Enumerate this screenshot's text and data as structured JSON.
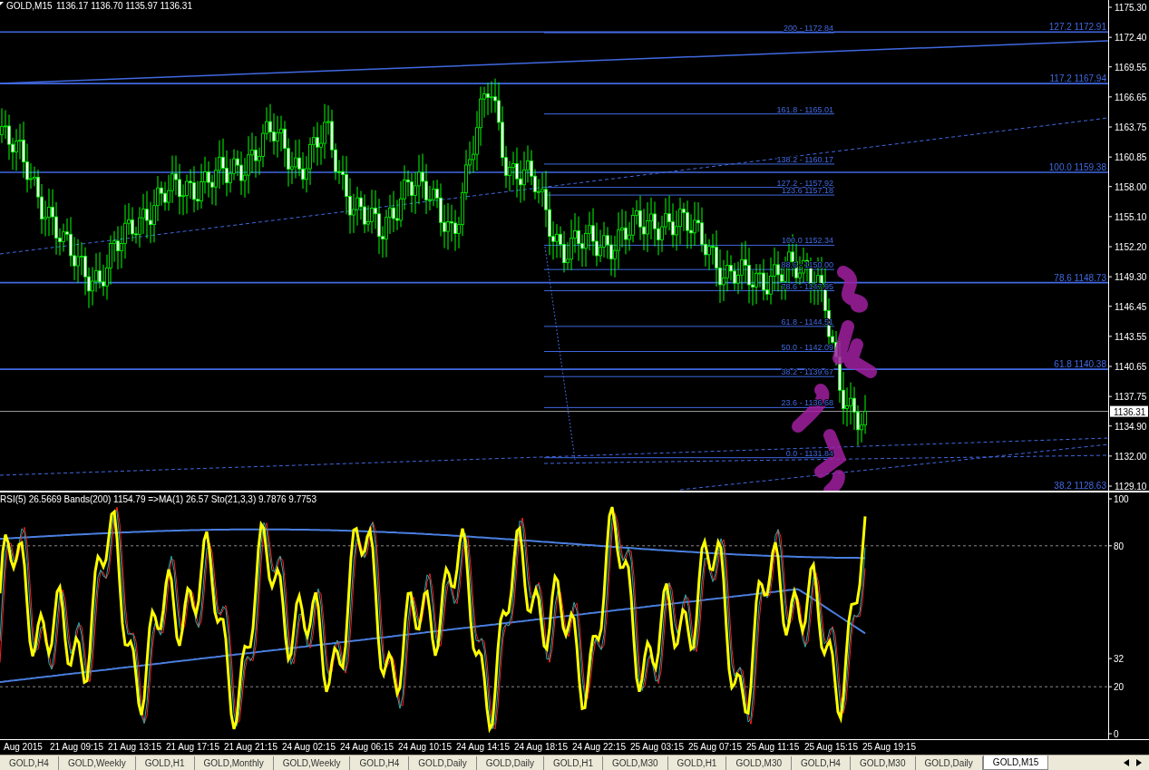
{
  "header": {
    "symbol": "GOLD,M15",
    "quote": "1136.17 1136.70 1135.97 1136.31"
  },
  "price_axis": {
    "ticks": [
      "1175.30",
      "1172.40",
      "1169.55",
      "1166.65",
      "1163.75",
      "1160.85",
      "1158.00",
      "1155.10",
      "1152.20",
      "1149.30",
      "1146.45",
      "1143.55",
      "1140.65",
      "1137.75",
      "1134.90",
      "1132.00",
      "1129.10"
    ],
    "current": "1136.31"
  },
  "fib_levels": [
    {
      "label": "200 - 1172.84"
    },
    {
      "label": "161.8 - 1165.01"
    },
    {
      "label": "138.2 - 1160.17"
    },
    {
      "label": "127.2 - 1157.92"
    },
    {
      "label": "123.6 1157.18"
    },
    {
      "label": "100.0 1152.34"
    },
    {
      "label": "88.6 - 1150.00"
    },
    {
      "label": "78.6 - 1147.95"
    },
    {
      "label": "61.8 - 1144.51"
    },
    {
      "label": "50.0 - 1142.09"
    },
    {
      "label": "38.2 - 1139.67"
    },
    {
      "label": "23.6 - 1136.68"
    },
    {
      "label": "0.0 - 1131.84"
    }
  ],
  "extension_levels": [
    {
      "label": "127.2 1172.91"
    },
    {
      "label": "117.2 1167.94"
    },
    {
      "label": "100.0   1159.38"
    },
    {
      "label": "78.6 1148.73"
    },
    {
      "label": "61.8 1140.38"
    },
    {
      "label": "38.2 1128.63"
    }
  ],
  "indicator": {
    "legend": "RSI(5) 26.5669  Bands(200) 1154.79  =>MA(1) 26.57  Sto(21,3,3) 9.7876 9.7753",
    "ticks": [
      "100",
      "80",
      "32",
      "20",
      "0"
    ]
  },
  "time_axis": [
    "Aug 2015",
    "21 Aug 09:15",
    "21 Aug 13:15",
    "21 Aug 17:15",
    "21 Aug 21:15",
    "24 Aug 02:15",
    "24 Aug 06:15",
    "24 Aug 10:15",
    "24 Aug 14:15",
    "24 Aug 18:15",
    "24 Aug 22:15",
    "25 Aug 03:15",
    "25 Aug 07:15",
    "25 Aug 11:15",
    "25 Aug 15:15",
    "25 Aug 19:15"
  ],
  "tabs": [
    {
      "label": "GOLD,H4",
      "selected": false
    },
    {
      "label": "GOLD,Weekly",
      "selected": false
    },
    {
      "label": "GOLD,H1",
      "selected": false
    },
    {
      "label": "GOLD,Monthly",
      "selected": false
    },
    {
      "label": "GOLD,Weekly",
      "selected": false
    },
    {
      "label": "GOLD,H4",
      "selected": false
    },
    {
      "label": "GOLD,Daily",
      "selected": false
    },
    {
      "label": "GOLD,Daily",
      "selected": false
    },
    {
      "label": "GOLD,H1",
      "selected": false
    },
    {
      "label": "GOLD,M30",
      "selected": false
    },
    {
      "label": "GOLD,H1",
      "selected": false
    },
    {
      "label": "GOLD,M30",
      "selected": false
    },
    {
      "label": "GOLD,H4",
      "selected": false
    },
    {
      "label": "GOLD,M30",
      "selected": false
    },
    {
      "label": "GOLD,Daily",
      "selected": false
    },
    {
      "label": "GOLD,M15",
      "selected": true
    }
  ]
}
